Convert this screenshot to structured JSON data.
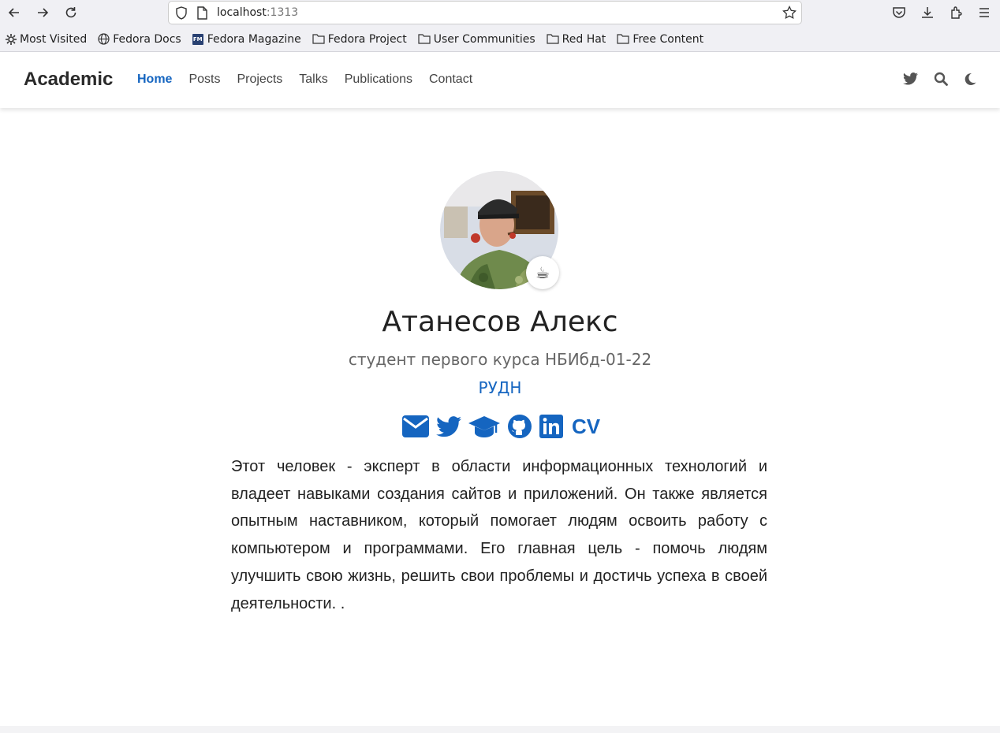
{
  "browser": {
    "url_host": "localhost",
    "url_port": ":1313",
    "bookmarks": [
      {
        "label": "Most Visited",
        "icon": "gear-icon"
      },
      {
        "label": "Fedora Docs",
        "icon": "globe-icon"
      },
      {
        "label": "Fedora Magazine",
        "icon": "fedora-magazine-icon"
      },
      {
        "label": "Fedora Project",
        "icon": "folder-icon"
      },
      {
        "label": "User Communities",
        "icon": "folder-icon"
      },
      {
        "label": "Red Hat",
        "icon": "folder-icon"
      },
      {
        "label": "Free Content",
        "icon": "folder-icon"
      }
    ],
    "fm_badge": "FM"
  },
  "site": {
    "brand": "Academic",
    "menu": [
      "Home",
      "Posts",
      "Projects",
      "Talks",
      "Publications",
      "Contact"
    ],
    "active_menu": "Home"
  },
  "profile": {
    "status_emoji": "☕",
    "name": "Атанесов Алекс",
    "role": "студент первого курса НБИбд-01-22",
    "organization": "РУДН",
    "social": [
      "envelope-icon",
      "twitter-icon",
      "graduation-cap-icon",
      "github-icon",
      "linkedin-icon"
    ],
    "cv_label": "CV",
    "bio": "Этот человек - эксперт в области информационных технологий и владеет навыками создания сайтов и приложений. Он также является опытным наставником, который помогает людям освоить работу с компьютером и программами. Его главная цель - помочь людям улучшить свою жизнь, решить свои проблемы и достичь успеха в своей деятельности. ."
  },
  "colors": {
    "accent": "#1565c0",
    "chrome_bg": "#f0f0f4"
  }
}
